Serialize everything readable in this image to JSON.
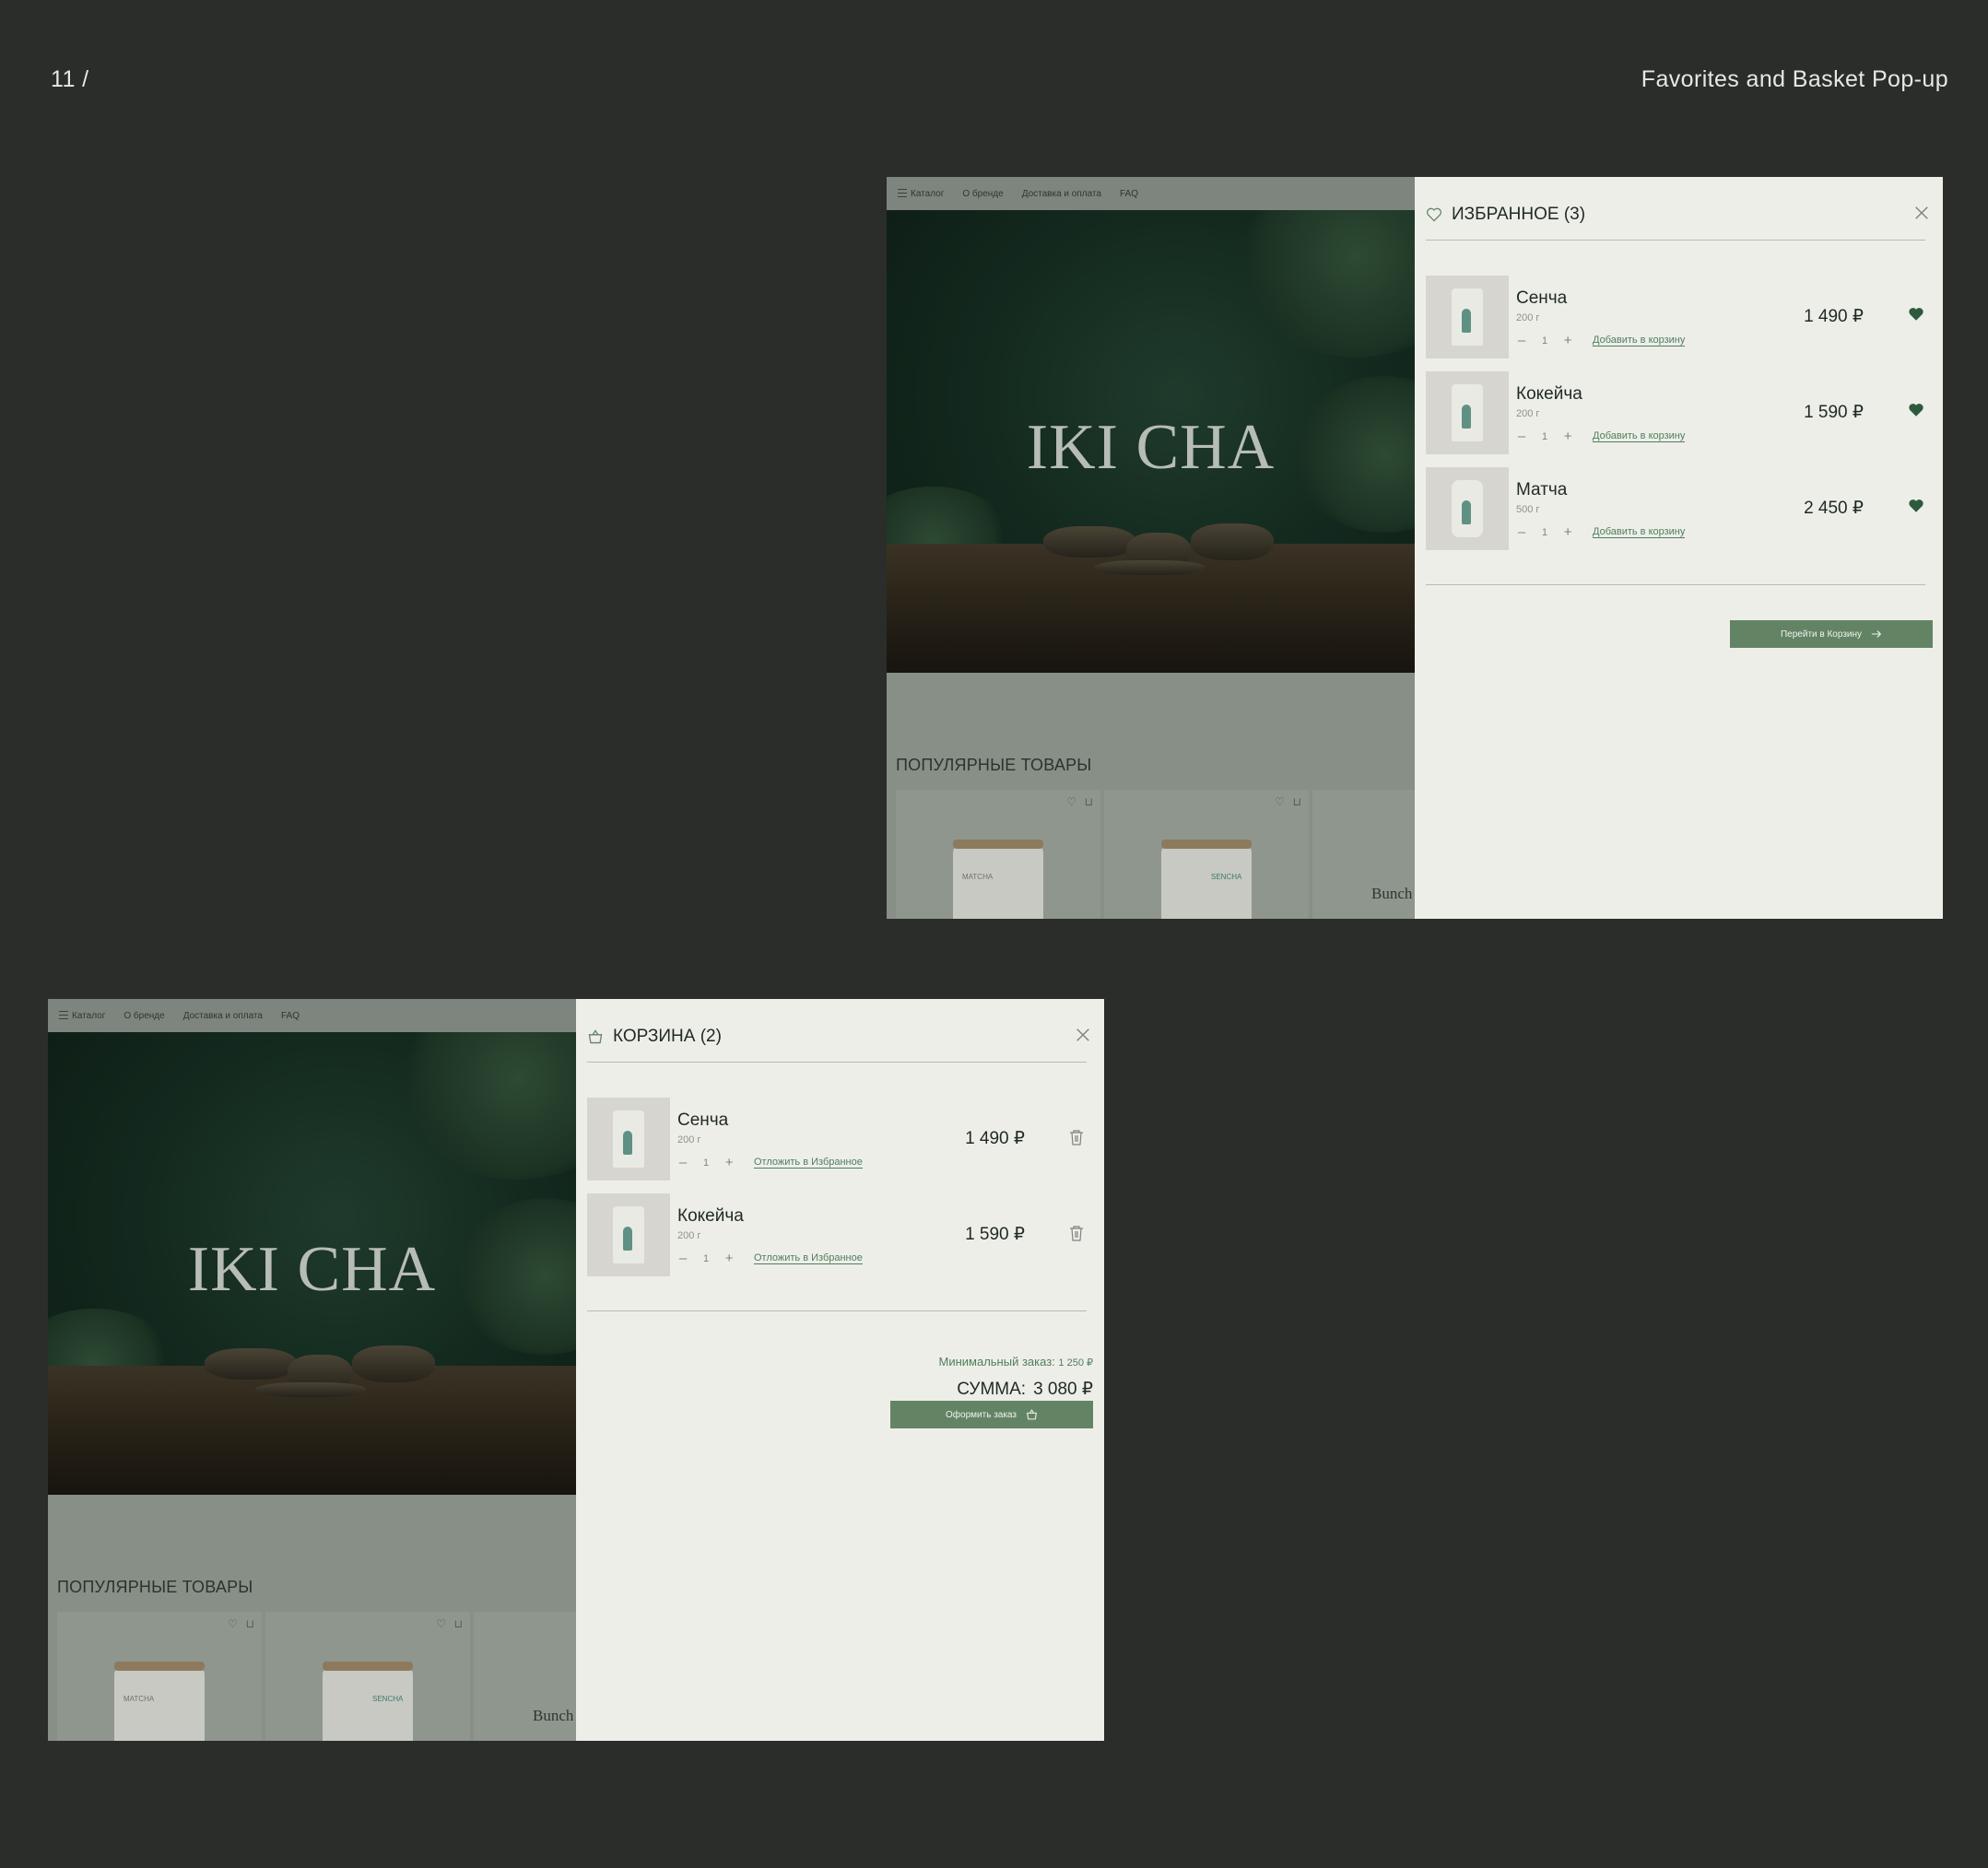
{
  "slide": {
    "number": "11 /",
    "title": "Favorites and Basket Pop-up"
  },
  "site": {
    "nav": [
      "Каталог",
      "О бренде",
      "Доставка и оплата",
      "FAQ"
    ],
    "logo": "IKI CHA",
    "popular_title": "ПОПУЛЯРНЫЕ ТОВАРЫ",
    "bunch_label": "Bunch",
    "card_labels": [
      "MATCHA",
      "SENCHA"
    ]
  },
  "favorites": {
    "title": "ИЗБРАННОЕ (3)",
    "items": [
      {
        "name": "Сенча",
        "weight": "200 г",
        "qty": "1",
        "link": "Добавить в корзину",
        "price": "1 490 ₽"
      },
      {
        "name": "Кокейча",
        "weight": "200 г",
        "qty": "1",
        "link": "Добавить в корзину",
        "price": "1 590 ₽"
      },
      {
        "name": "Матча",
        "weight": "500 г",
        "qty": "1",
        "link": "Добавить в корзину",
        "price": "2 450 ₽"
      }
    ],
    "cta": "Перейти в Корзину"
  },
  "basket": {
    "title": "КОРЗИНА (2)",
    "items": [
      {
        "name": "Сенча",
        "weight": "200 г",
        "qty": "1",
        "link": "Отложить в Избранное",
        "price": "1 490 ₽"
      },
      {
        "name": "Кокейча",
        "weight": "200 г",
        "qty": "1",
        "link": "Отложить в Избранное",
        "price": "1 590 ₽"
      }
    ],
    "min_order_label": "Минимальный заказ:",
    "min_order_value": "1 250 ₽",
    "sum_label": "СУММА:",
    "sum_value": "3 080 ₽",
    "cta": "Оформить заказ"
  },
  "colors": {
    "background": "#2a2d29",
    "panel": "#eeeee9",
    "accent": "#628464",
    "link": "#4f7f5c"
  },
  "icons": [
    "heart-outline-icon",
    "heart-filled-icon",
    "basket-icon",
    "close-icon",
    "trash-icon",
    "arrow-right-icon",
    "burger-menu-icon"
  ]
}
